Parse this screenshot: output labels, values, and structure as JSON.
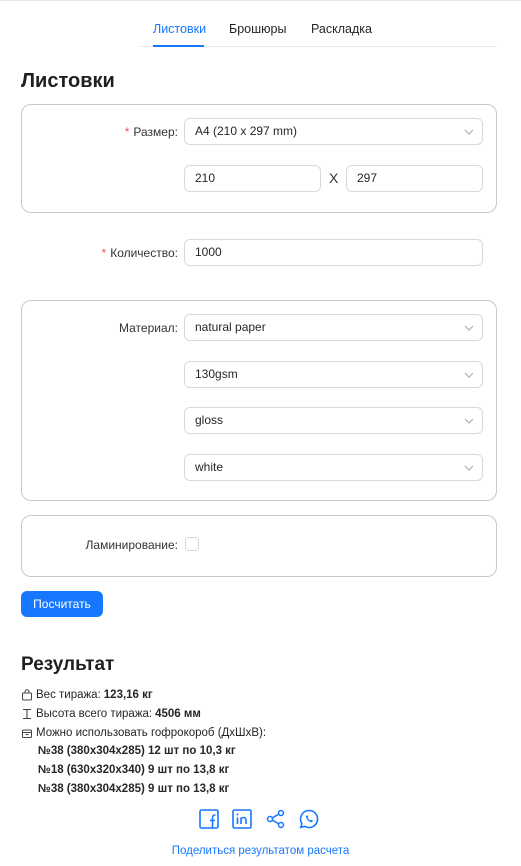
{
  "tabs": [
    "Листовки",
    "Брошюры",
    "Раскладка"
  ],
  "page_title": "Листовки",
  "size": {
    "label": "Размер",
    "value": "A4 (210 x 297 mm)",
    "width": "210",
    "height": "297",
    "separator": "X"
  },
  "quantity": {
    "label": "Количество",
    "value": "1000"
  },
  "material": {
    "label": "Материал",
    "paper": "natural paper",
    "weight": "130gsm",
    "finish": "gloss",
    "color": "white"
  },
  "lamination": {
    "label": "Ламинирование",
    "checked": false
  },
  "calculate_button": "Посчитать",
  "result": {
    "title": "Результат",
    "weight_label": "Вес тиража:",
    "weight_value": "123,16 кг",
    "height_label": "Высота всего тиража:",
    "height_value": "4506 мм",
    "boxes_label": "Можно использовать гофрокороб (ДхШхВ):",
    "boxes": [
      "№38 (380x304x285) 12 шт по 10,3 кг",
      "№18 (630x320x340) 9 шт по 13,8 кг",
      "№38 (380x304x285) 9 шт по 13,8 кг"
    ]
  },
  "share": {
    "icons": [
      "facebook-icon",
      "linkedin-icon",
      "share-icon",
      "whatsapp-icon"
    ],
    "link": "Поделиться результатом расчета"
  },
  "colors": {
    "accent": "#1677ff",
    "required": "#ff4d4f",
    "border": "#c9c9c9"
  }
}
